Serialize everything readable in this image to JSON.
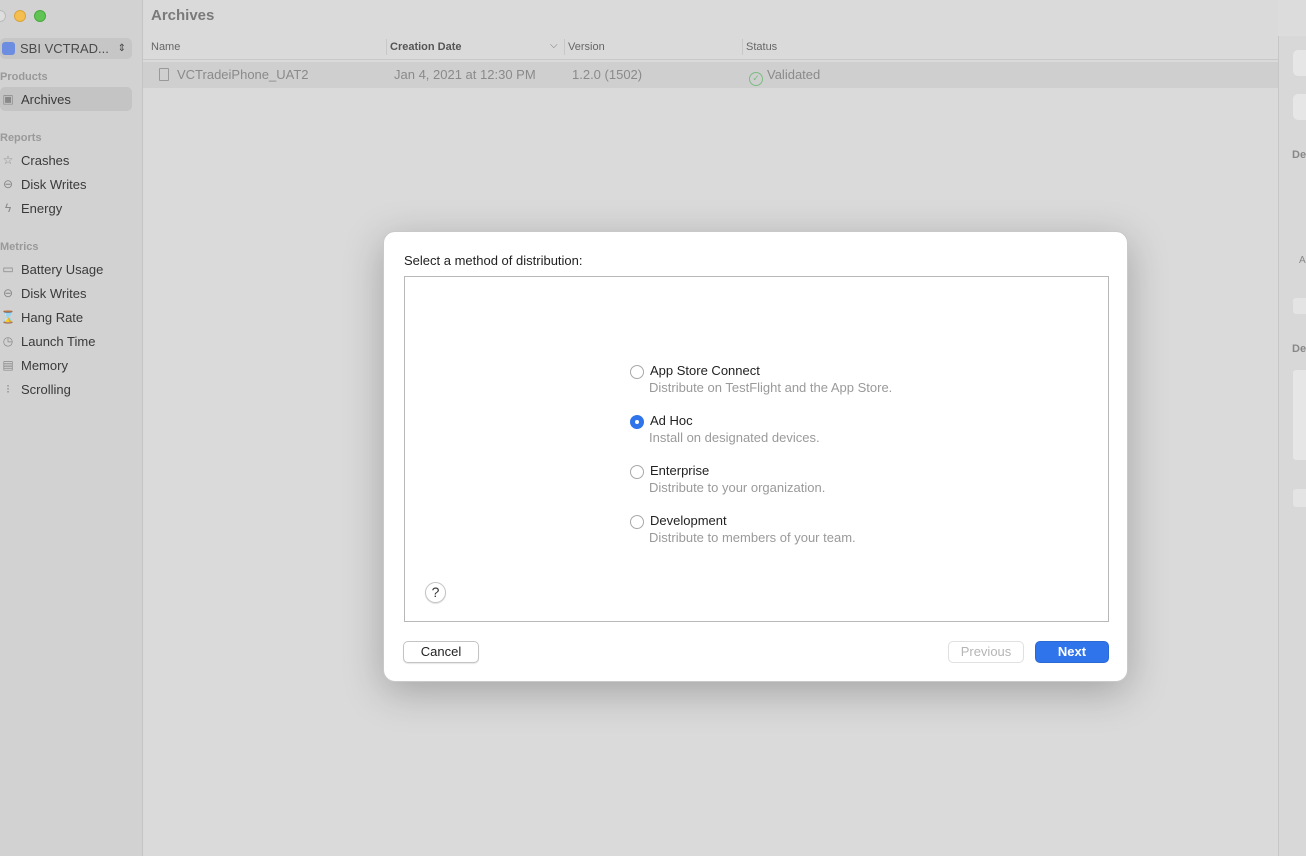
{
  "sidebar": {
    "app_name": "SBI VCTRAD...",
    "sections": {
      "products": "Products",
      "reports": "Reports",
      "metrics": "Metrics"
    },
    "items": {
      "archives": "Archives",
      "crashes": "Crashes",
      "disk_writes_reports": "Disk Writes",
      "energy": "Energy",
      "battery_usage": "Battery Usage",
      "disk_writes_metrics": "Disk Writes",
      "hang_rate": "Hang Rate",
      "launch_time": "Launch Time",
      "memory": "Memory",
      "scrolling": "Scrolling"
    }
  },
  "main": {
    "title": "Archives",
    "columns": {
      "name": "Name",
      "creation_date": "Creation Date",
      "version": "Version",
      "status": "Status"
    },
    "row": {
      "name": "VCTradeiPhone_UAT2",
      "creation_date": "Jan 4, 2021 at 12:30 PM",
      "version": "1.2.0 (1502)",
      "status": "Validated"
    }
  },
  "inspector": {
    "label_1": "De",
    "label_2": "De",
    "label_small": "A"
  },
  "modal": {
    "title": "Select a method of distribution:",
    "options": [
      {
        "title": "App Store Connect",
        "desc": "Distribute on TestFlight and the App Store.",
        "selected": false
      },
      {
        "title": "Ad Hoc",
        "desc": "Install on designated devices.",
        "selected": true
      },
      {
        "title": "Enterprise",
        "desc": "Distribute to your organization.",
        "selected": false
      },
      {
        "title": "Development",
        "desc": "Distribute to members of your team.",
        "selected": false
      }
    ],
    "help_label": "?",
    "cancel_label": "Cancel",
    "previous_label": "Previous",
    "next_label": "Next"
  },
  "colors": {
    "accent": "#2f74ea",
    "validated": "#7bbd82"
  }
}
